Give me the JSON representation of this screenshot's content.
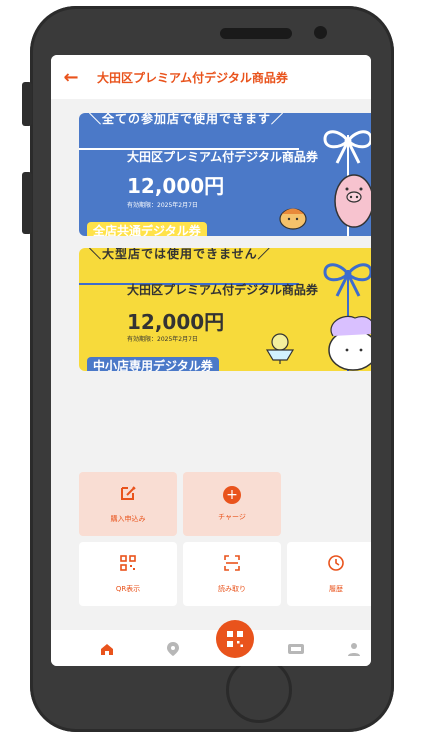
{
  "header": {
    "title": "大田区プレミアム付デジタル商品券"
  },
  "cards": [
    {
      "banner": "＼全ての参加店で使用できます／",
      "name": "大田区プレミアム付デジタル商品券",
      "amount": "12,000円",
      "expiry": "有効期限：2025年2月7日",
      "tag": "全店共通デジタル券",
      "bg": "#4b79c8"
    },
    {
      "banner": "＼大型店では使用できません／",
      "name": "大田区プレミアム付デジタル商品券",
      "amount": "12,000円",
      "expiry": "有効期限：2025年2月7日",
      "tag": "中小店専用デジタル券",
      "bg": "#f7da3b"
    }
  ],
  "actions": {
    "purchase": "購入申込み",
    "charge": "チャージ",
    "qr": "QR表示",
    "scan": "読み取り",
    "history": "履歴"
  },
  "icons": {
    "back": "arrow-left-icon",
    "purchase": "edit-icon",
    "charge": "plus-circle-icon",
    "qr": "qr-code-icon",
    "scan": "scan-icon",
    "history": "history-icon",
    "home": "home-icon",
    "map": "map-pin-icon",
    "center": "qr-code-icon",
    "ticket": "ticket-icon",
    "account": "user-icon"
  },
  "colors": {
    "accent": "#e9531c",
    "tile_bg_accent": "#f9ddd3",
    "card_blue": "#4b79c8",
    "card_yellow": "#f7da3b",
    "nav_inactive": "#b7b7b7"
  }
}
